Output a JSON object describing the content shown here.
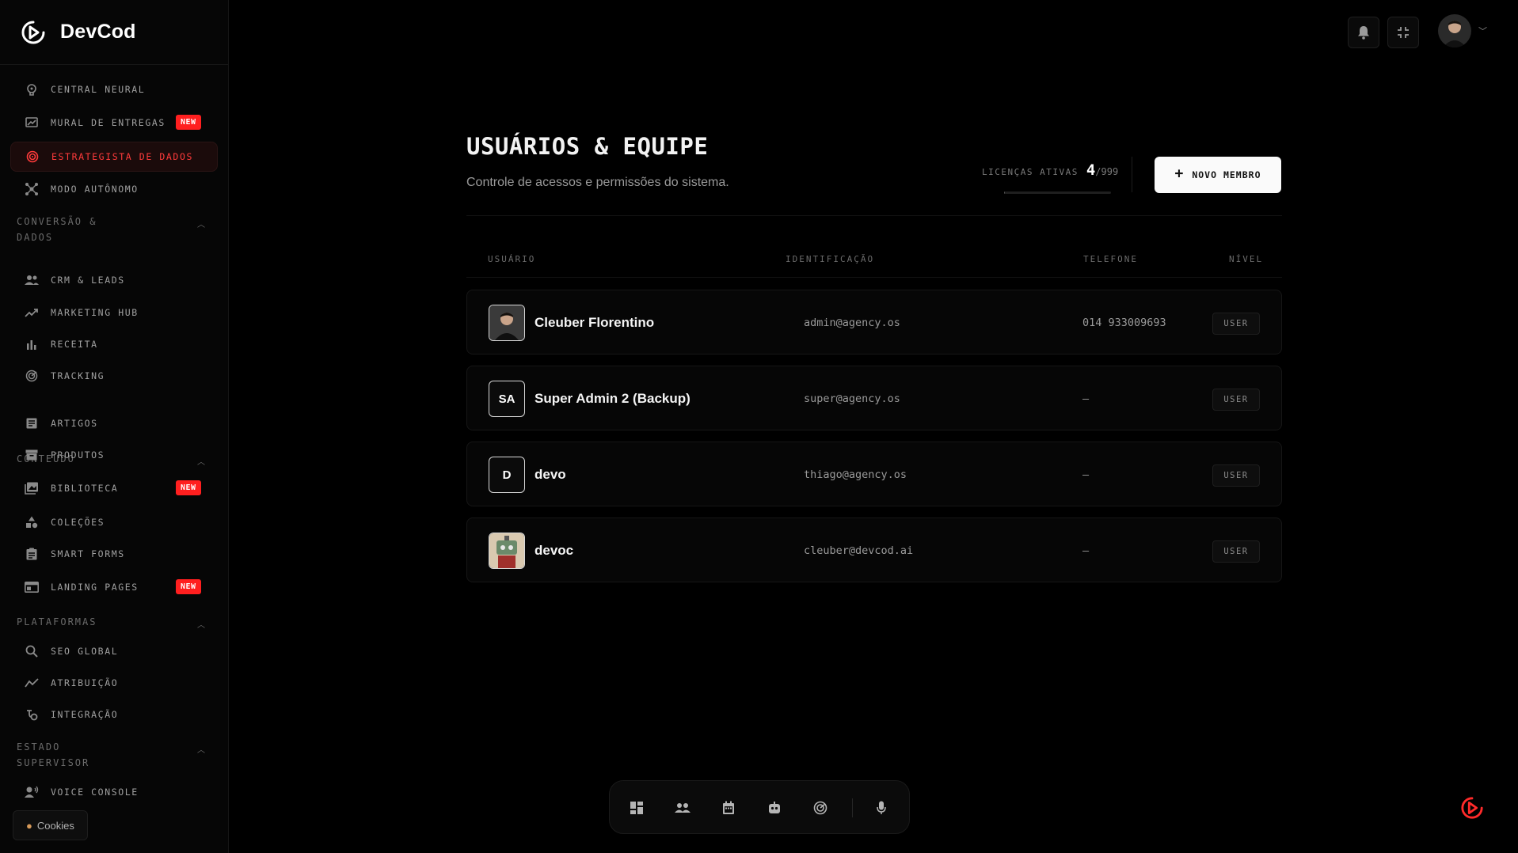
{
  "brand": {
    "name": "DevCod"
  },
  "sidebar": {
    "items": [
      {
        "key": "central",
        "label": "CENTRAL NEURAL",
        "icon": "brain-icon"
      },
      {
        "key": "mural",
        "label": "MURAL DE ENTREGAS",
        "icon": "board-icon",
        "badge": "NEW"
      },
      {
        "key": "estrategista",
        "label": "ESTRATEGISTA DE DADOS",
        "icon": "target-icon",
        "active": true
      },
      {
        "key": "modo",
        "label": "MODO AUTÔNOMO",
        "icon": "network-icon"
      },
      {
        "key": "crm",
        "label": "CRM & LEADS",
        "icon": "users-icon"
      },
      {
        "key": "marketing",
        "label": "MARKETING HUB",
        "icon": "trend-icon"
      },
      {
        "key": "receita",
        "label": "RECEITA",
        "icon": "bar-chart-icon"
      },
      {
        "key": "tracking",
        "label": "TRACKING",
        "icon": "radar-icon"
      },
      {
        "key": "artigos",
        "label": "ARTIGOS",
        "icon": "article-icon"
      },
      {
        "key": "produtos",
        "label": "PRODUTOS",
        "icon": "box-icon"
      },
      {
        "key": "biblioteca",
        "label": "BIBLIOTECA",
        "icon": "library-icon",
        "badge": "NEW"
      },
      {
        "key": "colecoes",
        "label": "COLEÇÕES",
        "icon": "shapes-icon"
      },
      {
        "key": "smartforms",
        "label": "SMART FORMS",
        "icon": "clipboard-icon"
      },
      {
        "key": "landing",
        "label": "LANDING PAGES",
        "icon": "web-icon",
        "badge": "NEW"
      },
      {
        "key": "seo",
        "label": "SEO GLOBAL",
        "icon": "search-icon"
      },
      {
        "key": "atribuicao",
        "label": "ATRIBUIÇÃO",
        "icon": "line-chart-icon"
      },
      {
        "key": "integracao",
        "label": "INTEGRAÇÃO",
        "icon": "plug-icon"
      },
      {
        "key": "voice",
        "label": "VOICE CONSOLE",
        "icon": "voice-icon"
      }
    ],
    "sections": [
      {
        "label": "CONVERSÃO & DADOS"
      },
      {
        "label": "CONTEÚDO"
      },
      {
        "label": "PLATAFORMAS"
      },
      {
        "label": "ESTADO SUPERVISOR"
      }
    ],
    "cookies_label": "Cookies"
  },
  "main": {
    "title": "USUÁRIOS & EQUIPE",
    "subtitle": "Controle de acessos e permissões do sistema.",
    "licenses": {
      "label": "LICENÇAS ATIVAS",
      "active": "4",
      "total": "/999",
      "used_fraction": 0.004
    },
    "new_member_label": "NOVO MEMBRO"
  },
  "table": {
    "columns": {
      "user": "USUÁRIO",
      "id": "IDENTIFICAÇÃO",
      "phone": "TELEFONE",
      "level": "NÍVEL"
    },
    "rows": [
      {
        "name": "Cleuber Florentino",
        "email": "admin@agency.os",
        "phone": "014 933009693",
        "level": "USER",
        "avatar_type": "photo"
      },
      {
        "name": "Super Admin 2 (Backup)",
        "email": "super@agency.os",
        "phone": "—",
        "level": "USER",
        "avatar_type": "initials",
        "initials": "SA"
      },
      {
        "name": "devo",
        "email": "thiago@agency.os",
        "phone": "—",
        "level": "USER",
        "avatar_type": "initials",
        "initials": "D"
      },
      {
        "name": "devoc",
        "email": "cleuber@devcod.ai",
        "phone": "—",
        "level": "USER",
        "avatar_type": "robot"
      }
    ]
  },
  "colors": {
    "accent": "#ff2a2a",
    "background": "#000000",
    "panel": "#060606"
  }
}
